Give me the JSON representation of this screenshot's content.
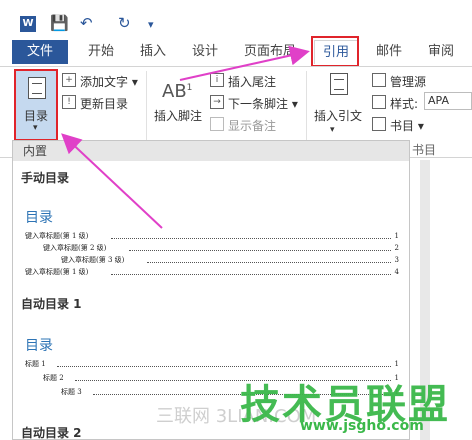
{
  "titlebar": {
    "app_icon": "W",
    "icons": [
      "save-icon",
      "undo-icon",
      "redo-icon",
      "customize-icon"
    ]
  },
  "tabs": {
    "file": "文件",
    "items": [
      "开始",
      "插入",
      "设计",
      "页面布局",
      "引用",
      "邮件",
      "审阅"
    ],
    "active": "引用"
  },
  "ribbon": {
    "toc_label": "目录",
    "add_text": "添加文字",
    "update_toc": "更新目录",
    "footnote_big": "AB",
    "footnote_sup": "1",
    "insert_footnote": "插入脚注",
    "insert_endnote": "插入尾注",
    "next_footnote": "下一条脚注",
    "show_notes": "显示备注",
    "insert_citation": "插入引文",
    "manage_sources": "管理源",
    "style_label": "样式:",
    "style_value": "APA",
    "bibliography": "书目",
    "group_label": "书目"
  },
  "dropdown": {
    "header": "内置",
    "manual_title": "手动目录",
    "auto1_title": "自动目录 1",
    "auto2_title": "自动目录 2",
    "toc_heading": "目录",
    "manual_lines": [
      {
        "text": "键入章标题(第 1 级)",
        "page": "1"
      },
      {
        "text": "键入章标题(第 2 级)",
        "page": "2"
      },
      {
        "text": "键入章标题(第 3 级)",
        "page": "3"
      },
      {
        "text": "键入章标题(第 1 级)",
        "page": "4"
      }
    ],
    "auto1_lines": [
      {
        "text": "标题 1",
        "page": "1"
      },
      {
        "text": "标题 2",
        "page": "1"
      },
      {
        "text": "标题 3",
        "page": "1"
      }
    ]
  },
  "watermark": {
    "main": "技术员联盟",
    "url": "www.jsgho.com",
    "gray": "三联网 3LIAN.COM"
  },
  "colors": {
    "accent": "#2b579a",
    "highlight": "#e0242b",
    "arrow": "#e040c8",
    "watermark": "#3bb84a"
  }
}
